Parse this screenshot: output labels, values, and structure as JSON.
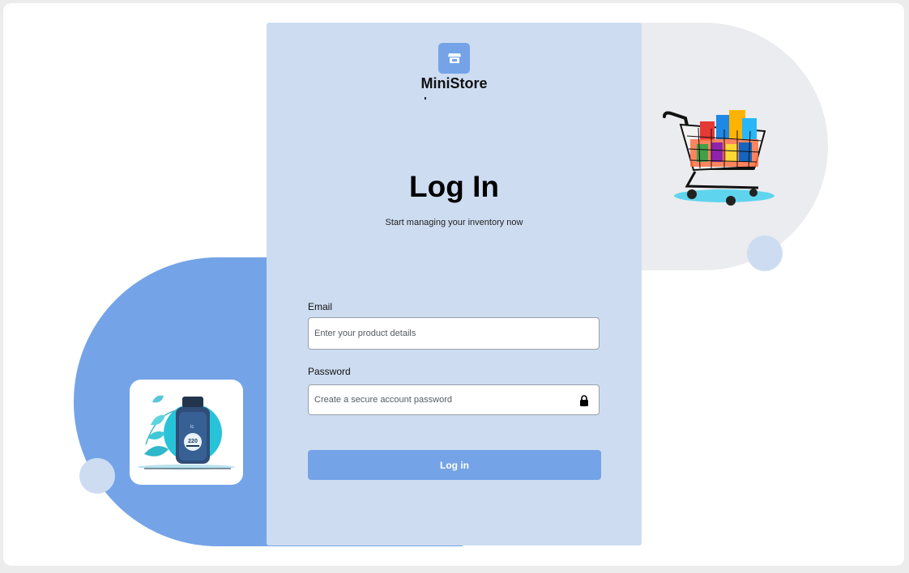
{
  "brand": {
    "name": "MiniStore",
    "logo_icon": "store-icon"
  },
  "login": {
    "title": "Log In",
    "subtitle": "Start managing your inventory now",
    "email_label": "Email",
    "email_placeholder": "Enter your product details",
    "password_label": "Password",
    "password_placeholder": "Create a secure account password",
    "password_icon": "lock-icon",
    "submit_label": "Log in"
  },
  "illustrations": {
    "product_label": "220",
    "product_sublabel": "lc"
  },
  "colors": {
    "accent": "#74a4e7",
    "panel": "#cddcf1",
    "soft_gray": "#ebecef"
  }
}
